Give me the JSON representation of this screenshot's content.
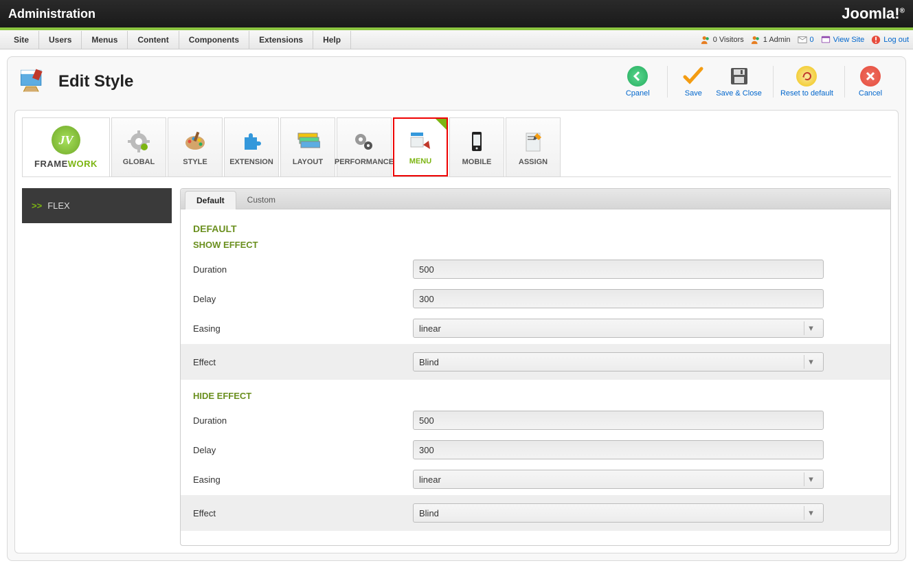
{
  "topbar": {
    "title": "Administration",
    "brand": "Joomla!"
  },
  "menubar": {
    "items": [
      "Site",
      "Users",
      "Menus",
      "Content",
      "Components",
      "Extensions",
      "Help"
    ],
    "status": {
      "visitors": "0 Visitors",
      "admins": "1 Admin",
      "messages": "0",
      "viewsite": "View Site",
      "logout": "Log out"
    }
  },
  "page": {
    "title": "Edit Style",
    "toolbar": {
      "cpanel": "Cpanel",
      "save": "Save",
      "saveclose": "Save & Close",
      "reset": "Reset to default",
      "cancel": "Cancel"
    }
  },
  "tabs": {
    "framework_frame": "FRAME",
    "framework_work": "WORK",
    "global": "GLOBAL",
    "style": "STYLE",
    "extension": "EXTENSION",
    "layout": "LAYOUT",
    "performance": "PERFORMANCE",
    "menu": "MENU",
    "mobile": "MOBILE",
    "assign": "ASSIGN"
  },
  "sidebar": {
    "flex_prefix": ">>",
    "flex": "FLEX"
  },
  "subtabs": {
    "default": "Default",
    "custom": "Custom"
  },
  "panel": {
    "section": "DEFAULT",
    "show": {
      "title": "SHOW EFFECT",
      "duration_lbl": "Duration",
      "duration_val": "500",
      "delay_lbl": "Delay",
      "delay_val": "300",
      "easing_lbl": "Easing",
      "easing_val": "linear",
      "effect_lbl": "Effect",
      "effect_val": "Blind"
    },
    "hide": {
      "title": "HIDE EFFECT",
      "duration_lbl": "Duration",
      "duration_val": "500",
      "delay_lbl": "Delay",
      "delay_val": "300",
      "easing_lbl": "Easing",
      "easing_val": "linear",
      "effect_lbl": "Effect",
      "effect_val": "Blind"
    }
  }
}
